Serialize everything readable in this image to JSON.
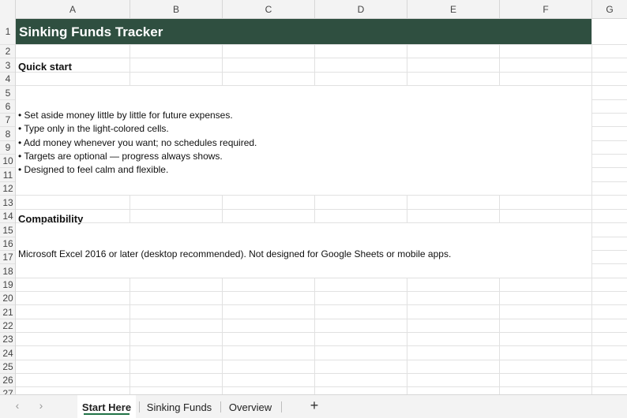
{
  "columns": [
    "A",
    "B",
    "C",
    "D",
    "E",
    "F",
    "G"
  ],
  "rows": [
    "1",
    "2",
    "3",
    "4",
    "5",
    "6",
    "7",
    "8",
    "9",
    "10",
    "11",
    "12",
    "13",
    "14",
    "15",
    "16",
    "17",
    "18",
    "19",
    "20",
    "21",
    "22",
    "23",
    "24",
    "25",
    "26",
    "27"
  ],
  "sheet": {
    "title": "Sinking Funds Tracker",
    "quick_start_heading": "Quick start",
    "bullets": [
      "• Set aside money little by little for future expenses.",
      "• Type only in the light-colored cells.",
      "• Add money whenever you want; no schedules required.",
      "• Targets are optional — progress always shows.",
      "• Designed to feel calm and flexible."
    ],
    "compat_heading": "Compatibility",
    "compat_text": "Microsoft Excel 2016 or later (desktop recommended). Not designed for Google Sheets or mobile apps."
  },
  "tabs": {
    "items": [
      "Start Here",
      "Sinking Funds",
      "Overview"
    ],
    "active": "Start Here",
    "prev_glyph": "‹",
    "next_glyph": "›",
    "add_glyph": "+"
  },
  "colors": {
    "banner": "#2f4f40",
    "accent": "#217346"
  }
}
